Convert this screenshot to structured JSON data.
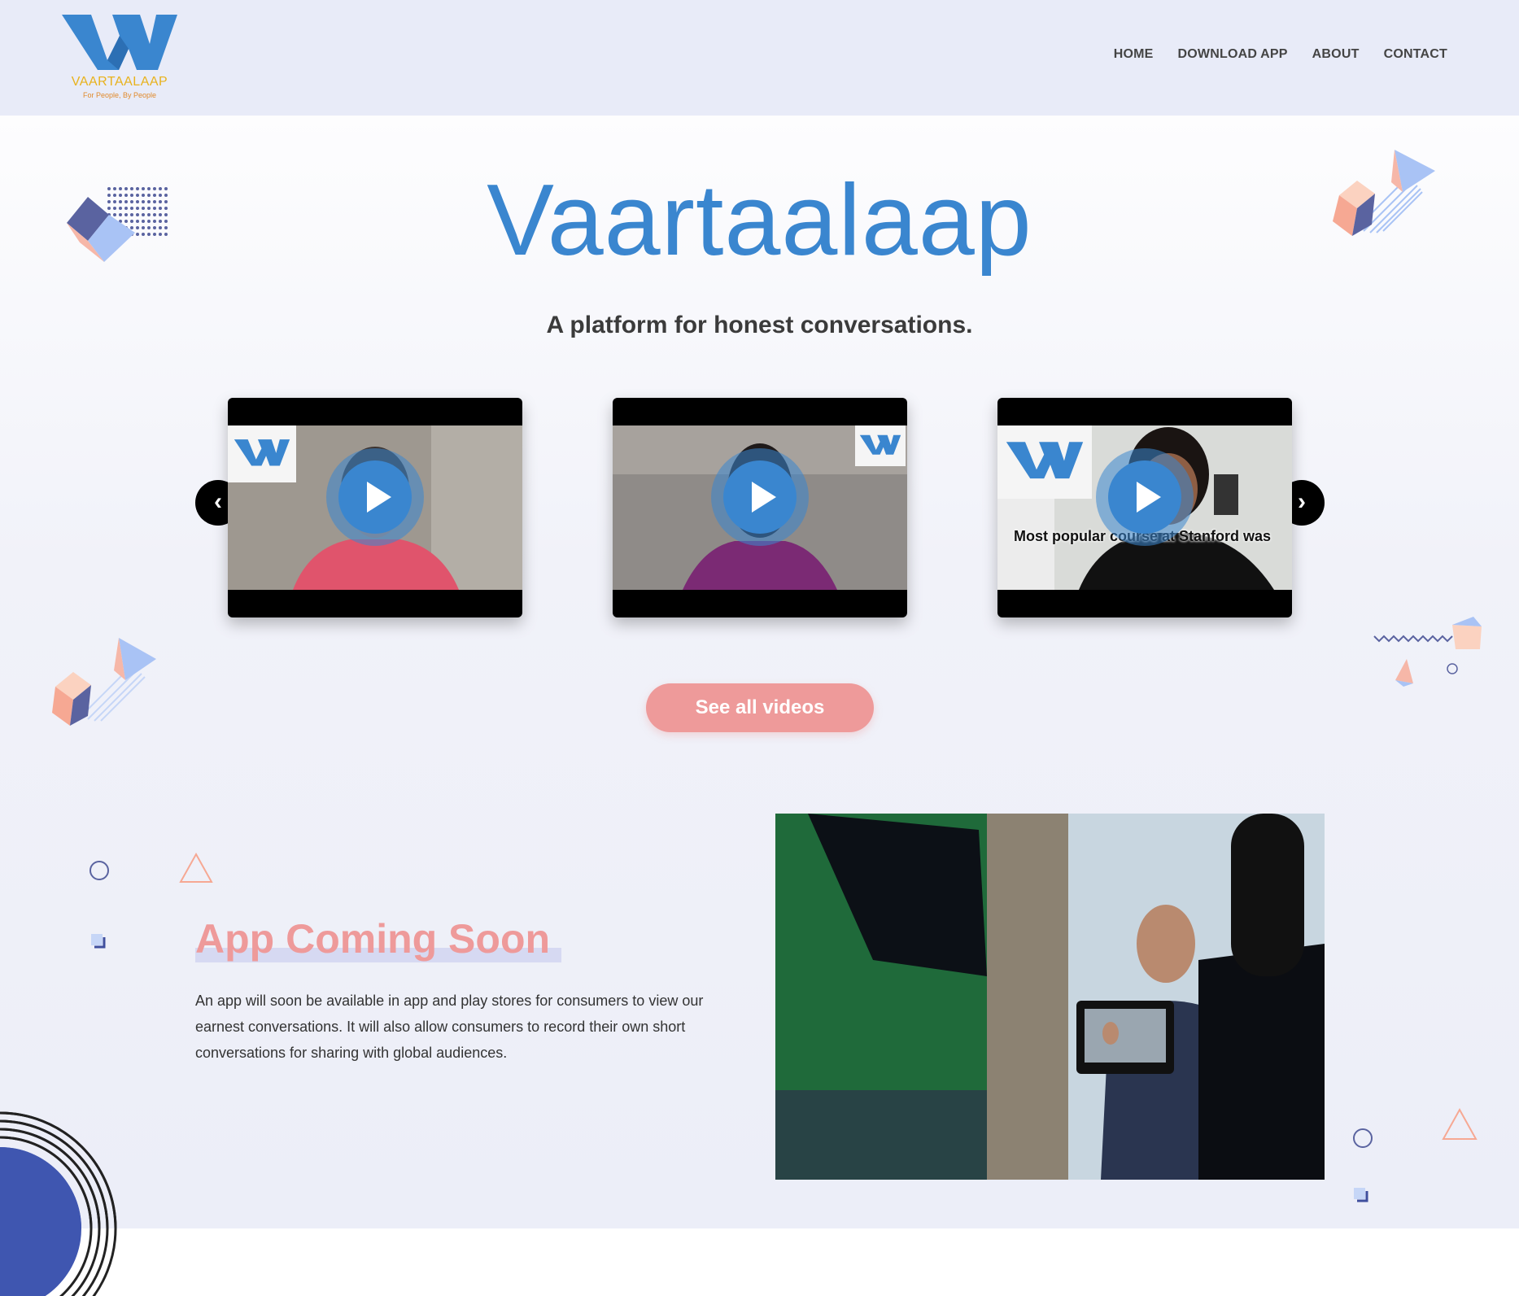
{
  "brand": {
    "name": "VAARTAALAAP",
    "tagline": "For People, By People",
    "primary_color": "#3a86cf",
    "accent_color": "#ee9a9a",
    "header_bg": "#e8ebf8"
  },
  "nav": {
    "items": [
      {
        "label": "HOME"
      },
      {
        "label": "DOWNLOAD APP"
      },
      {
        "label": "ABOUT"
      },
      {
        "label": "CONTACT"
      }
    ]
  },
  "hero": {
    "title": "Vaartaalaap",
    "subtitle": "A platform for honest conversations."
  },
  "videos": [
    {
      "thumbnail": "woman-pink-cardigan",
      "icon": "play-icon"
    },
    {
      "thumbnail": "woman-purple-top",
      "icon": "play-icon"
    },
    {
      "thumbnail": "man-dark-shirt",
      "icon": "play-icon",
      "caption": "Most popular course at Stanford was"
    }
  ],
  "carousel": {
    "prev_icon": "chevron-left-icon",
    "next_icon": "chevron-right-icon",
    "prev_glyph": "‹",
    "next_glyph": "›"
  },
  "cta": {
    "label": "See all videos"
  },
  "app_section": {
    "title": "App Coming Soon",
    "body": "An app will soon be available in app and play stores for consumers to view our earnest conversations. It will also allow consumers to record their own short conversations for sharing with global audiences."
  }
}
